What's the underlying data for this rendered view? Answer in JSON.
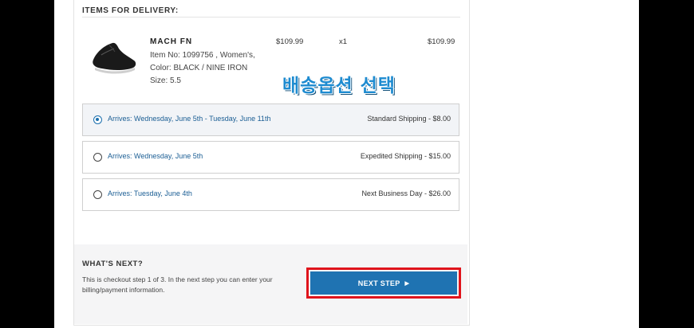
{
  "delivery": {
    "section_title": "ITEMS FOR DELIVERY:"
  },
  "product": {
    "name": "MACH FN",
    "item_line": "Item No: 1099756 , Women's,",
    "color_line": "Color: BLACK / NINE IRON",
    "size_line": "Size: 5.5",
    "price": "$109.99",
    "quantity": "x1",
    "total": "$109.99",
    "thumb_icon": "shoe-icon"
  },
  "annotation": {
    "korean_label": "배송옵션 선택"
  },
  "shipping_options": [
    {
      "arrives": "Arrives: Wednesday, June 5th - Tuesday, June 11th",
      "method": "Standard Shipping - $8.00",
      "selected": true
    },
    {
      "arrives": "Arrives: Wednesday, June 5th",
      "method": "Expedited Shipping - $15.00",
      "selected": false
    },
    {
      "arrives": "Arrives: Tuesday, June 4th",
      "method": "Next Business Day - $26.00",
      "selected": false
    }
  ],
  "next": {
    "heading": "WHAT'S NEXT?",
    "description": "This is checkout step 1 of 3. In the next step you can enter your billing/payment information.",
    "button_label": "NEXT STEP",
    "button_icon": "caret-right-icon"
  },
  "colors": {
    "accent": "#1f73b2",
    "highlight_outline": "#e0141c",
    "link": "#1b5e94"
  }
}
